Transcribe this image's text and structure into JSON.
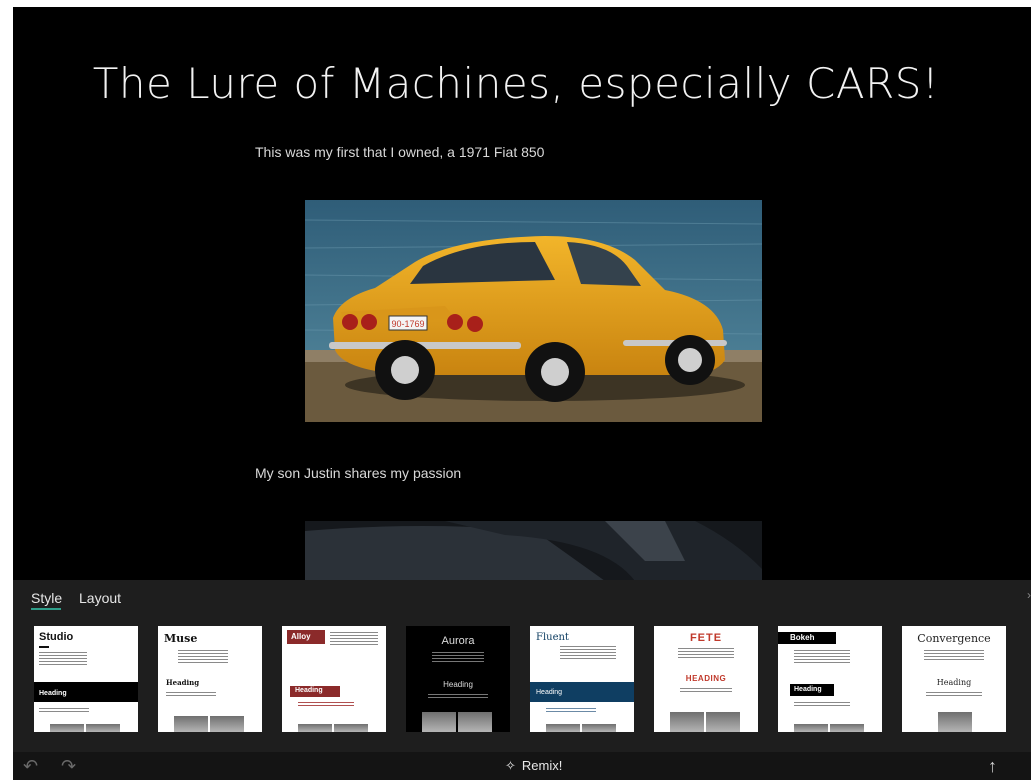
{
  "slide": {
    "title": "The Lure of Machines, especially CARS!",
    "caption1": "This was my first that I owned, a 1971 Fiat 850",
    "caption2": "My son Justin shares my passion",
    "plate": "90-1769"
  },
  "panel": {
    "tabs": [
      "Style",
      "Layout"
    ],
    "active_tab": "Style",
    "themes": [
      {
        "name": "Studio",
        "heading": "Heading"
      },
      {
        "name": "Muse",
        "heading": "Heading"
      },
      {
        "name": "Alloy",
        "heading": "Heading"
      },
      {
        "name": "Aurora",
        "heading": "Heading"
      },
      {
        "name": "Fluent",
        "heading": "Heading"
      },
      {
        "name": "FETE",
        "heading": "HEADING"
      },
      {
        "name": "Bokeh",
        "heading": "Heading"
      },
      {
        "name": "Convergence",
        "heading": "Heading"
      }
    ]
  },
  "toolbar": {
    "undo_icon": "undo-icon",
    "redo_icon": "redo-icon",
    "remix_label": "Remix!",
    "share_icon": "up-arrow-icon"
  },
  "colors": {
    "accent": "#2f9e8a",
    "alloy_red": "#8b2a2a",
    "fluent_blue": "#0f3e62",
    "fete_red": "#c0392b"
  }
}
